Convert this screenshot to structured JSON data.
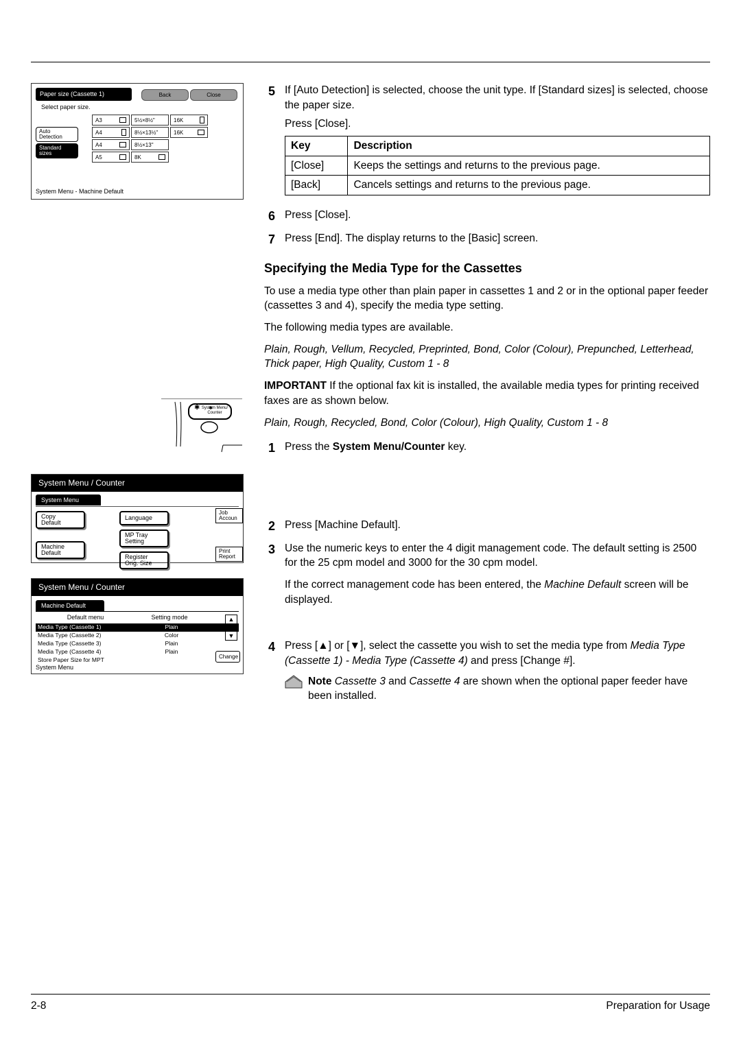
{
  "ss1": {
    "title": "Paper size (Cassette 1)",
    "back": "Back",
    "close": "Close",
    "subtext": "Select paper size.",
    "side_buttons": [
      "Auto\nDetection",
      "Standard\nsizes"
    ],
    "col1": [
      "A3",
      "A4",
      "A4",
      "A5"
    ],
    "col2": [
      "5½×8½\"",
      "8½×13½\"",
      "8½×13\"",
      "8K"
    ],
    "col3": [
      "16K",
      "16K"
    ],
    "footer": "System Menu      -   Machine Default"
  },
  "step5": {
    "text1": "If [Auto Detection] is selected, choose the unit type. If [Standard sizes] is selected, choose the paper size.",
    "text2": "Press [Close].",
    "th1": "Key",
    "th2": "Description",
    "r1k": "[Close]",
    "r1d": "Keeps the settings and returns to the previous page.",
    "r2k": "[Back]",
    "r2d": "Cancels settings and returns to the previous page."
  },
  "step6": "Press [Close].",
  "step7": "Press [End]. The display returns to the [Basic] screen.",
  "section_title": "Specifying the Media Type for the Cassettes",
  "section_intro": "To use a media type other than plain paper in cassettes 1 and 2 or in the optional paper feeder (cassettes 3 and 4), specify the media type setting.",
  "section_avail": "The following media types are available.",
  "media_list1": "Plain, Rough, Vellum, Recycled, Preprinted, Bond, Color (Colour), Prepunched, Letterhead, Thick paper, High Quality, Custom 1 - 8",
  "important_label": "IMPORTANT",
  "important_text": " If the optional fax kit is installed, the available media types for printing received faxes are as shown below.",
  "media_list2": "Plain, Rough, Recycled, Bond, Color (Colour), High Quality, Custom 1 - 8",
  "step1": {
    "pre": "Press the ",
    "bold": "System Menu/Counter",
    "post": " key."
  },
  "ss2": {
    "title": "System Menu / Counter",
    "tab": "System Menu",
    "b1": "Copy\nDefault",
    "b2": "Machine\nDefault",
    "b3": "Language",
    "b4": "MP Tray\nSetting",
    "b5": "Register\nOrig. Size",
    "p1": "Job\nAccoun",
    "p2": "Print\nReport"
  },
  "step2": "Press [Machine Default].",
  "step3": {
    "p1": "Use the numeric keys to enter the 4 digit management code. The default setting is 2500 for the 25 cpm model and 3000 for the 30 cpm model.",
    "p2a": "If the correct management code has been entered, the ",
    "p2i": "Machine Default",
    "p2b": " screen will be displayed."
  },
  "ss3": {
    "title": "System Menu / Counter",
    "tab": "Machine Default",
    "th1": "Default menu",
    "th2": "Setting mode",
    "rows": [
      {
        "menu": "Media Type (Cassette 1)",
        "mode": "Plain"
      },
      {
        "menu": "Media Type (Cassette 2)",
        "mode": "Color"
      },
      {
        "menu": "Media Type (Cassette 3)",
        "mode": "Plain"
      },
      {
        "menu": "Media Type (Cassette 4)",
        "mode": "Plain"
      },
      {
        "menu": "Store Paper Size for MPT",
        "mode": ""
      }
    ],
    "change": "Change",
    "footer": "System Menu"
  },
  "step4": {
    "pre": "Press [",
    "mid1": "] or [",
    "mid2": "], select the cassette you wish to set the media type from ",
    "italic": "Media Type (Cassette 1) - Media Type (Cassette 4)",
    "post": " and press [Change #].",
    "note_bold": "Note ",
    "note_i1": "Cassette 3",
    "note_mid": " and ",
    "note_i2": "Cassette 4",
    "note_post": " are shown when the optional paper feeder have been installed."
  },
  "footer": {
    "page": "2-8",
    "label": "Preparation for Usage"
  },
  "key_label": "System Menu/\nCounter"
}
